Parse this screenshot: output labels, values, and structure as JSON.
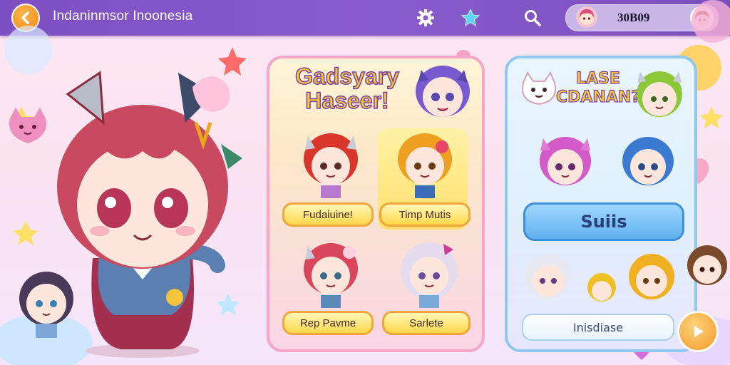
{
  "topbar": {
    "title": "Indaninmsor Inoonesia",
    "back_icon": "back-arrow-icon",
    "icons": [
      "gear-icon",
      "star-icon",
      "search-icon"
    ],
    "profile": {
      "text": "30B09"
    }
  },
  "left_panel": {
    "title": "Gadsyary Haseer!",
    "cards": [
      {
        "label": "Fudaiuine!"
      },
      {
        "label": "Timp Mutis"
      },
      {
        "label": "Rep Pavme"
      },
      {
        "label": "Sarlete"
      }
    ]
  },
  "right_panel": {
    "title": "LASE CDANAN?",
    "primary_button": "Suiis",
    "secondary_button": "Inisdiase"
  },
  "colors": {
    "topbar": "#7d4fc1",
    "accent_orange": "#f28a12",
    "left_panel_border": "#f5a6c9",
    "right_panel_border": "#8fc8f0",
    "button_yellow": "#ffd84a",
    "button_blue": "#5fb0f0"
  }
}
